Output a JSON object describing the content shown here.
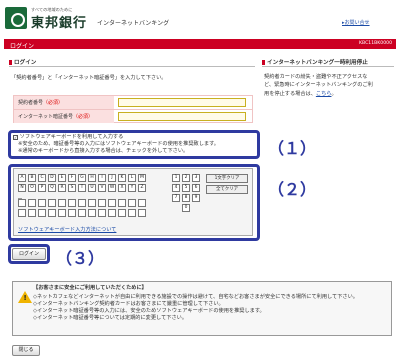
{
  "header": {
    "tagline": "すべての地域のために",
    "bank_name": "東邦銀行",
    "app_title": "インターネットバンキング",
    "help_link": "お問い合せ"
  },
  "title_bar": {
    "title": "ログイン",
    "code": "KBC11BK0000"
  },
  "login": {
    "heading": "ログイン",
    "instruction": "「契約者番号」と「インターネット暗証番号」を入力して下さい。",
    "contract_label": "契約者番号",
    "password_label": "インターネット暗証番号",
    "required_mark": "（必須）"
  },
  "suspend": {
    "heading": "インターネットバンキング一時利用停止",
    "lines": [
      "契約者カードの紛失・盗難や不正アクセスな",
      "ど、緊急時にインターネットバンキングのご利",
      "用を停止する場合は、"
    ],
    "link": "こちら",
    "period": "。"
  },
  "software_kb": {
    "checkbox_label": "ソフトウェアキーボードを利用して入力する",
    "notes": [
      "※安全のため、暗証番号等の入力にはソフトウェアキーボードの使用を推奨致します。",
      "※通常のキーボードから直接入力する場合は、チェックを外して下さい。"
    ]
  },
  "keyboard": {
    "row1": [
      "A",
      "B",
      "C",
      "D",
      "E",
      "F",
      "G",
      "H",
      "I",
      "J",
      "K",
      "L",
      "M"
    ],
    "row2": [
      "N",
      "O",
      "P",
      "Q",
      "R",
      "S",
      "T",
      "U",
      "V",
      "W",
      "X",
      "Y",
      "Z"
    ],
    "numbers": [
      "1",
      "2",
      "3",
      "4",
      "5",
      "6",
      "7",
      "8",
      "9",
      "0"
    ],
    "clear_one": "1文字クリア",
    "clear_all": "全てクリア",
    "help_link": "ソフトウェアキーボード入力方法について"
  },
  "annotations": {
    "n1": "（１）",
    "n2": "（２）",
    "n3": "（３）"
  },
  "login_button": "ログイン",
  "notice": {
    "title": "【お客さまに安全にご利用していただくために】",
    "items": [
      "◇ネットカフェなどインターネットが自由に利用できる施設での操作は避けて、自宅などお客さまが安全にできる場所にて利用して下さい。",
      "◇インターネットバンキング契約者カードはお客さまにて厳重に管理して下さい。",
      "◇インターネット暗証番号等の入力には、安全のためソフトウェアキーボードの使用を推奨します。",
      "◇インターネット暗証番号等については定期的に変更して下さい。"
    ]
  },
  "close_button": "閉じる",
  "colors": {
    "accent_red": "#cc0022",
    "annotation_blue": "#2f3aa0",
    "brand_green": "#1a6a3a"
  }
}
